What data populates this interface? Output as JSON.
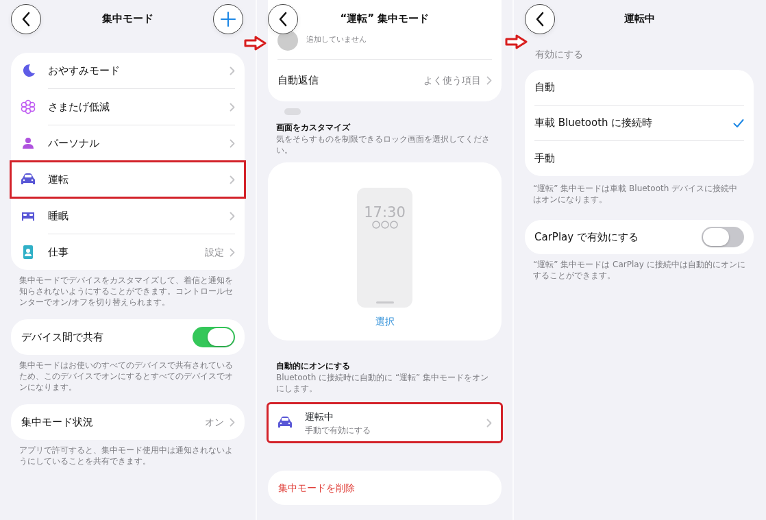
{
  "screens": [
    {
      "kind": "modes",
      "title": "集中モード",
      "modes": [
        {
          "label": "おやすみモード",
          "kind": "moon",
          "color": "#5e5ce6",
          "highlighted": false
        },
        {
          "label": "さまたげ低減",
          "kind": "flower",
          "color": "#bf5af2",
          "highlighted": false
        },
        {
          "label": "パーソナル",
          "kind": "person",
          "color": "#af52de",
          "highlighted": false
        },
        {
          "label": "運転",
          "kind": "car",
          "color": "#5856d6",
          "highlighted": true
        },
        {
          "label": "睡眠",
          "kind": "bed",
          "color": "#5856d6",
          "highlighted": false
        },
        {
          "label": "仕事",
          "kind": "badge",
          "color": "#30b0c7",
          "value": "設定",
          "highlighted": false
        }
      ],
      "modes_footer": "集中モードでデバイスをカスタマイズして、着信と通知を知らされないようにすることができます。コントロールセンターでオン/オフを切り替えられます。",
      "share": {
        "label": "デバイス間で共有",
        "on": true
      },
      "share_footer": "集中モードはお使いのすべてのデバイスで共有されているため、このデバイスでオンにするとすべてのデバイスでオンになります。",
      "status": {
        "label": "集中モード状況",
        "value": "オン"
      },
      "status_footer": "アプリで許可すると、集中モード使用中は通知されないようにしていることを共有できます。"
    },
    {
      "kind": "detail",
      "title": "“運転” 集中モード",
      "faded_text": "追加していません",
      "auto_reply": {
        "label": "自動返信",
        "value": "よく使う項目"
      },
      "customize": {
        "heading": "画面をカスタマイズ",
        "description": "気をそらすものを制限できるロック画面を選択してください。",
        "clock": "17:30",
        "select": "選択"
      },
      "auto_on": {
        "heading": "自動的にオンにする",
        "description": "Bluetooth に接続時に自動的に “運転” 集中モードをオンにします。",
        "row": {
          "title": "運転中",
          "subtitle": "手動で有効にする",
          "highlighted": true
        }
      },
      "delete": "集中モードを削除"
    },
    {
      "kind": "trigger",
      "title": "運転中",
      "section_label": "有効にする",
      "options": [
        {
          "label": "自動",
          "selected": false
        },
        {
          "label": "車載 Bluetooth に接続時",
          "selected": true
        },
        {
          "label": "手動",
          "selected": false
        }
      ],
      "options_footer": "“運転” 集中モードは車載 Bluetooth デバイスに接続中はオンになります。",
      "carplay": {
        "label": "CarPlay で有効にする",
        "on": false
      },
      "carplay_footer": "“運転” 集中モードは CarPlay に接続中は自動的にオンにすることができます。"
    }
  ]
}
